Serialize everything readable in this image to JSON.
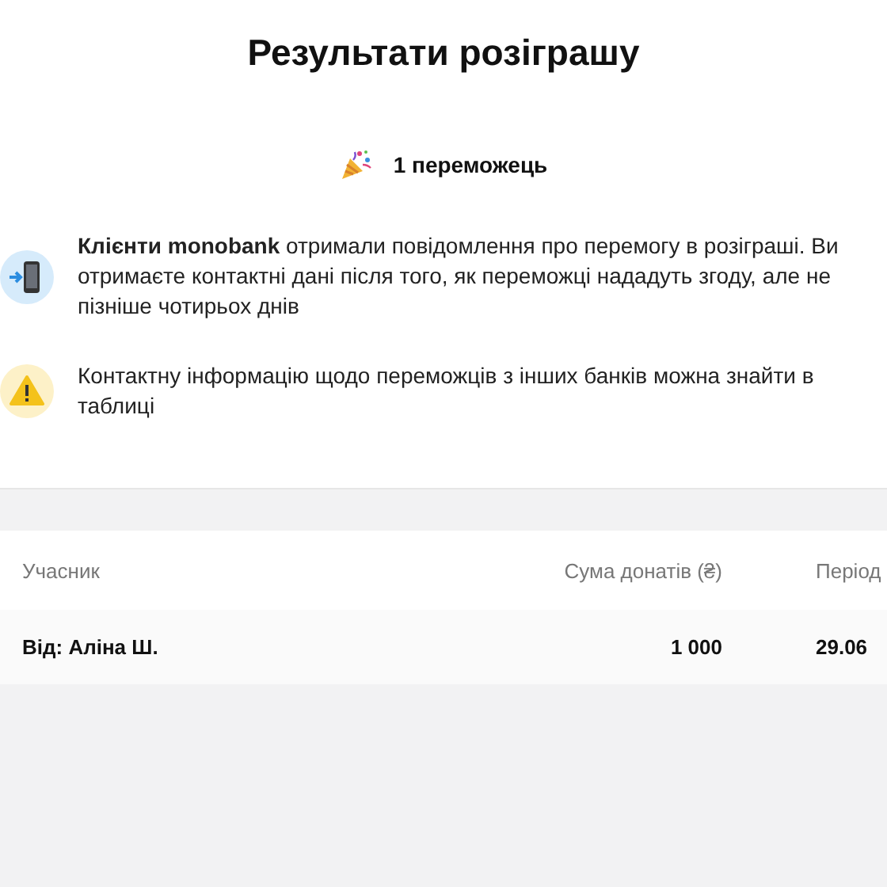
{
  "title": "Результати розіграшу",
  "winners": {
    "count_text": "1 переможець"
  },
  "notices": [
    {
      "kind": "phone",
      "text": "**Клієнти monobank** отримали повідомлення про перемогу в розіграші. Ви отримаєте контактні дані після того, як переможці нададуть згоду, але не пізніше чотирьох днів"
    },
    {
      "kind": "warning",
      "text": "Контактну інформацію щодо переможців з інших банків можна знайти в таблиці"
    }
  ],
  "table": {
    "columns": [
      "Учасник",
      "Сума донатів (₴)",
      "Період"
    ],
    "rows": [
      [
        "Від: Аліна Ш.",
        "1 000",
        "29.06"
      ]
    ]
  }
}
